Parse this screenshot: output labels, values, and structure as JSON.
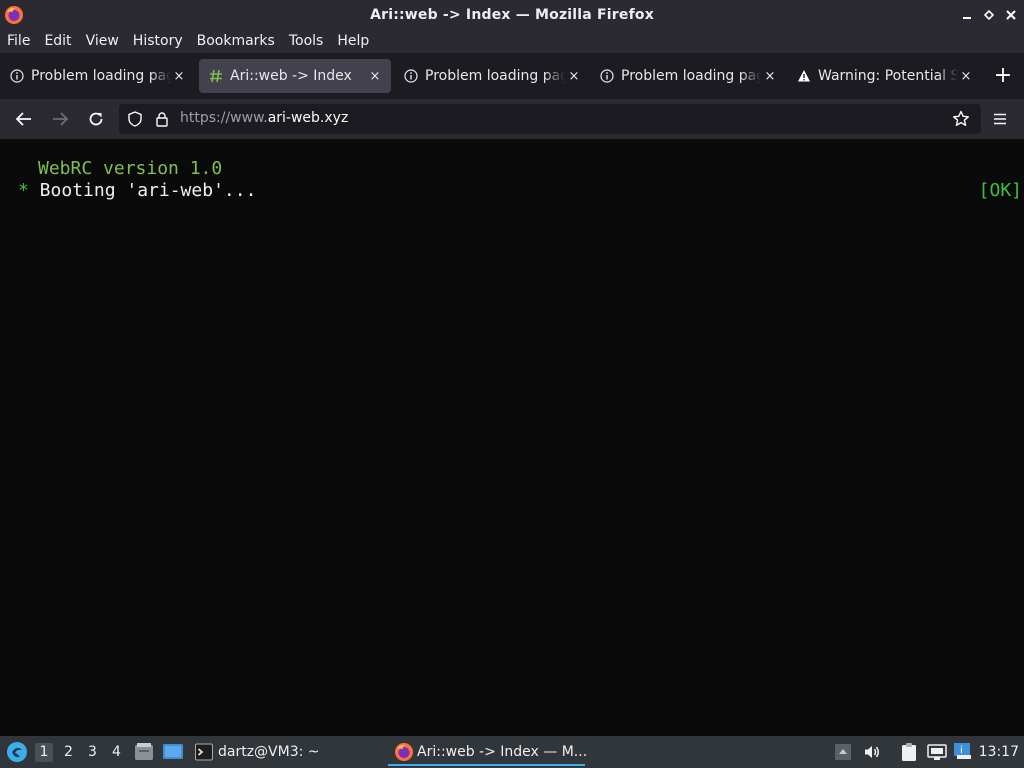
{
  "window": {
    "title": "Ari::web -> Index — Mozilla Firefox"
  },
  "menu": [
    "File",
    "Edit",
    "View",
    "History",
    "Bookmarks",
    "Tools",
    "Help"
  ],
  "tabs": [
    {
      "label": "Problem loading page",
      "icon": "info-icon",
      "active": false
    },
    {
      "label": "Ari::web -> Index",
      "icon": "hash-icon",
      "active": true
    },
    {
      "label": "Problem loading page",
      "icon": "info-icon",
      "active": false
    },
    {
      "label": "Problem loading page",
      "icon": "info-icon",
      "active": false
    },
    {
      "label": "Warning: Potential Security Risk Ahead",
      "icon": "warning-icon",
      "active": false
    }
  ],
  "tab_close_glyph": "×",
  "new_tab_glyph": "+",
  "urlbar": {
    "prefix": "https://www.",
    "domain": "ari-web.xyz"
  },
  "console": {
    "version_line": "WebRC version 1.0",
    "bullet": "*",
    "boot_line": " Booting 'ari-web'...",
    "status": "[OK]"
  },
  "taskbar": {
    "desktops": [
      "1",
      "2",
      "3",
      "4"
    ],
    "terminal_task": "dartz@VM3: ~",
    "firefox_task": "Ari::web -> Index — M...",
    "clock": "13:17"
  },
  "colors": {
    "console_bg": "#0a0a0a",
    "version_green": "#7fbf4f",
    "ok_green": "#3fbf3f",
    "taskbar_bg": "#31363b",
    "accent": "#3daee9"
  }
}
